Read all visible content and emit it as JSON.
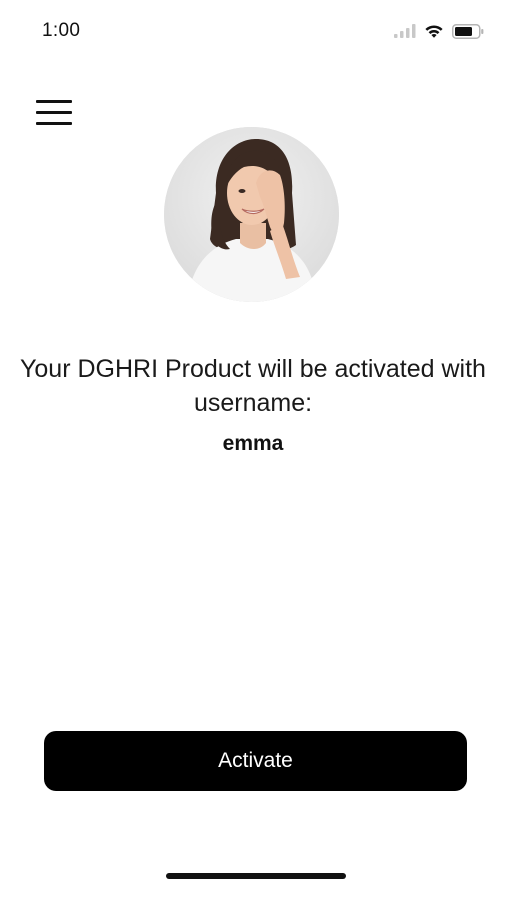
{
  "status_bar": {
    "time": "1:00",
    "icons": [
      "cellular-signal-icon",
      "wifi-icon",
      "battery-icon"
    ]
  },
  "menu": {
    "icon": "hamburger-menu-icon"
  },
  "avatar": {
    "description_icon": "user-avatar-photo"
  },
  "activation": {
    "message": "Your DGHRI Product will be activated with username:",
    "username": "emma"
  },
  "actions": {
    "activate_label": "Activate"
  },
  "colors": {
    "background": "#ffffff",
    "primary_button": "#000000",
    "primary_button_text": "#ffffff",
    "text": "#1a1a1a"
  }
}
